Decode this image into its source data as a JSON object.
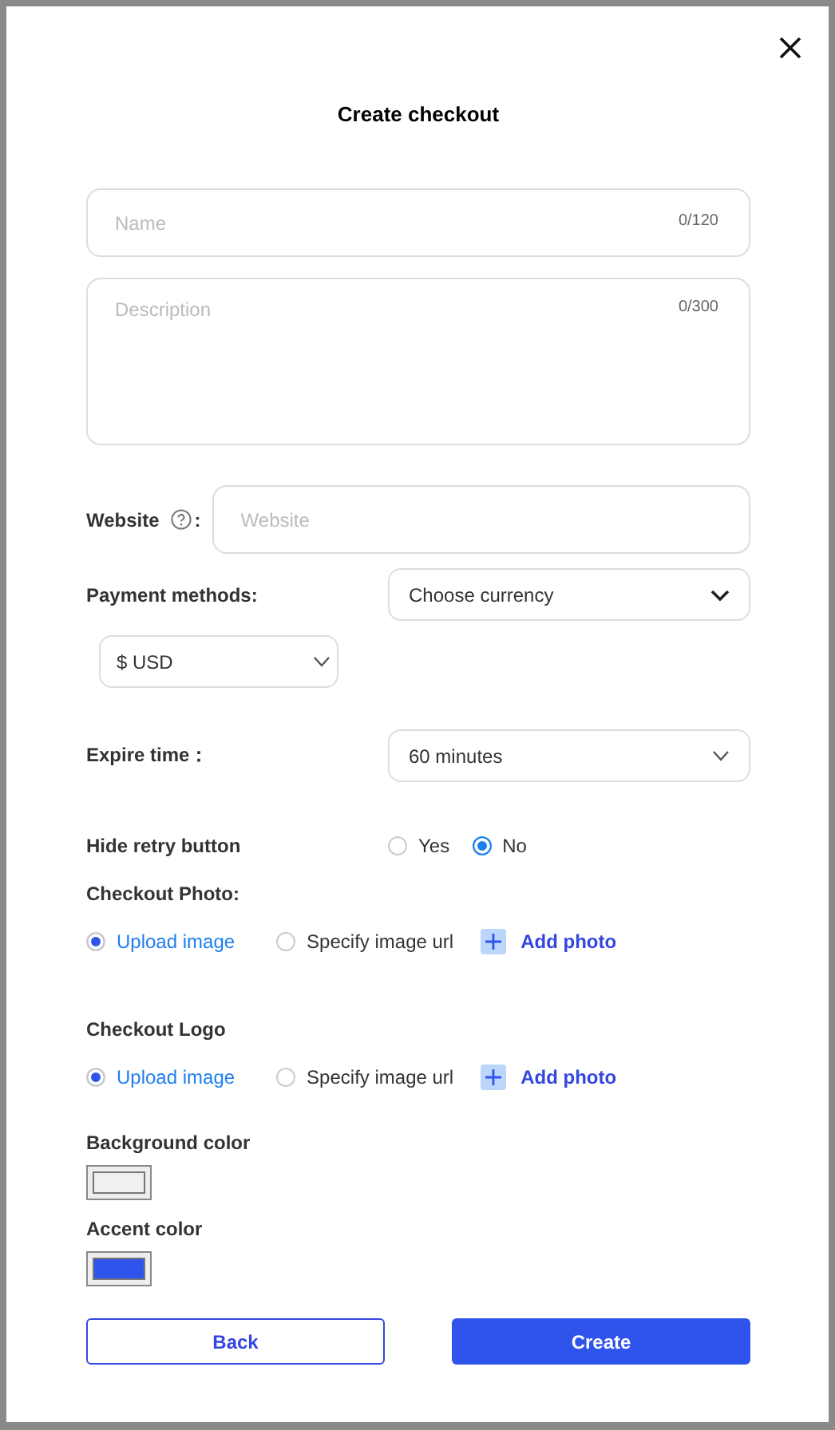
{
  "dialog": {
    "title": "Create checkout"
  },
  "name_field": {
    "placeholder": "Name",
    "counter": "0/120"
  },
  "description_field": {
    "placeholder": "Description",
    "counter": "0/300"
  },
  "website": {
    "label": "Website",
    "colon": ":",
    "placeholder": "Website"
  },
  "payment_methods": {
    "label": "Payment methods:",
    "currency_select": "Choose currency",
    "currency_value": "$ USD"
  },
  "expire_time": {
    "label": "Expire time：",
    "value": "60 minutes"
  },
  "hide_retry": {
    "label": "Hide retry button",
    "options": [
      {
        "label": "Yes",
        "selected": false
      },
      {
        "label": "No",
        "selected": true
      }
    ]
  },
  "image_sections": [
    {
      "label": "Checkout Photo:",
      "options": [
        {
          "label": "Upload image",
          "selected": true
        },
        {
          "label": "Specify image url",
          "selected": false
        }
      ],
      "add_label": "Add photo"
    },
    {
      "label": "Checkout Logo",
      "options": [
        {
          "label": "Upload image",
          "selected": true
        },
        {
          "label": "Specify image url",
          "selected": false
        }
      ],
      "add_label": "Add photo"
    }
  ],
  "colors": [
    {
      "label": "Background color",
      "color": "#f0f0f0"
    },
    {
      "label": "Accent color",
      "color": "#2f54eb"
    }
  ],
  "buttons": [
    {
      "label": "Back",
      "kind": "secondary"
    },
    {
      "label": "Create",
      "kind": "primary"
    }
  ]
}
